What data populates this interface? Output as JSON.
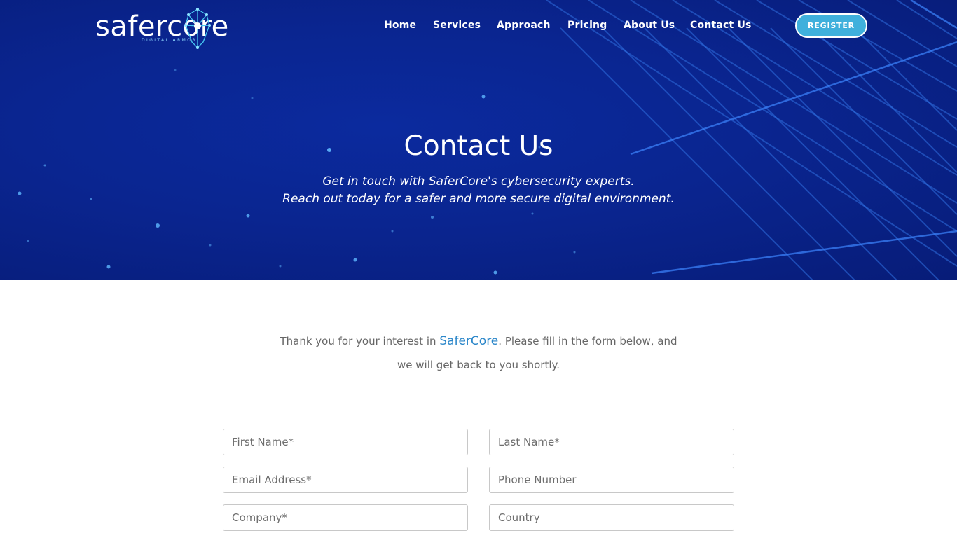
{
  "brand": {
    "logo_text": "safercore",
    "logo_subtext": "DIGITAL ARMOR"
  },
  "nav": {
    "items": [
      {
        "label": "Home"
      },
      {
        "label": "Services"
      },
      {
        "label": "Approach"
      },
      {
        "label": "Pricing"
      },
      {
        "label": "About Us"
      },
      {
        "label": "Contact Us"
      }
    ],
    "register_label": "REGISTER"
  },
  "hero": {
    "title": "Contact Us",
    "subtitle_line1": "Get in touch with SaferCore's cybersecurity experts.",
    "subtitle_line2": "Reach out today for a safer and more secure digital environment."
  },
  "intro": {
    "before": "Thank you for your interest in ",
    "brand": "SaferCore",
    "after_line1": ". Please fill in the form below, and",
    "line2": "we will get back to you shortly."
  },
  "form": {
    "first_name_placeholder": "First Name*",
    "last_name_placeholder": "Last Name*",
    "email_placeholder": "Email Address*",
    "phone_placeholder": "Phone Number",
    "company_placeholder": "Company*",
    "country_placeholder": "Country"
  },
  "colors": {
    "hero_bg": "#0a2590",
    "accent": "#3fb0dc",
    "brand_link": "#2a86c9"
  },
  "icons": {
    "logo_mark": "shield-network-icon"
  }
}
